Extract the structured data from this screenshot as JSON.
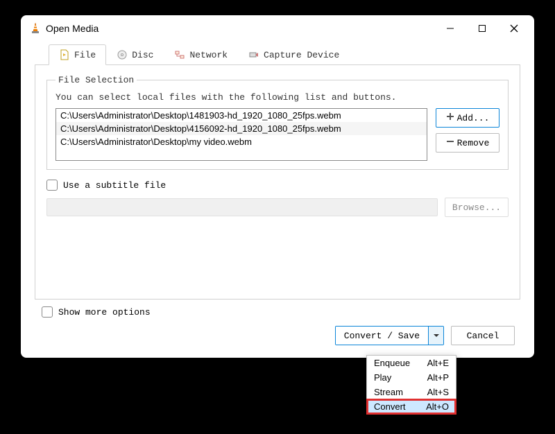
{
  "window": {
    "title": "Open Media"
  },
  "tabs": {
    "file": "File",
    "disc": "Disc",
    "network": "Network",
    "capture": "Capture Device"
  },
  "file_selection": {
    "legend": "File Selection",
    "description": "You can select local files with the following list and buttons.",
    "files": [
      "C:\\Users\\Administrator\\Desktop\\1481903-hd_1920_1080_25fps.webm",
      "C:\\Users\\Administrator\\Desktop\\4156092-hd_1920_1080_25fps.webm",
      "C:\\Users\\Administrator\\Desktop\\my video.webm"
    ],
    "add_label": "Add...",
    "remove_label": "Remove"
  },
  "subtitle": {
    "checkbox_label": "Use a subtitle file",
    "browse_label": "Browse..."
  },
  "show_more_label": "Show more options",
  "footer": {
    "convert_save_label": "Convert / Save",
    "cancel_label": "Cancel"
  },
  "dropdown": {
    "items": [
      {
        "label": "Enqueue",
        "shortcut": "Alt+E"
      },
      {
        "label": "Play",
        "shortcut": "Alt+P"
      },
      {
        "label": "Stream",
        "shortcut": "Alt+S"
      },
      {
        "label": "Convert",
        "shortcut": "Alt+O"
      }
    ],
    "selected_index": 3
  }
}
